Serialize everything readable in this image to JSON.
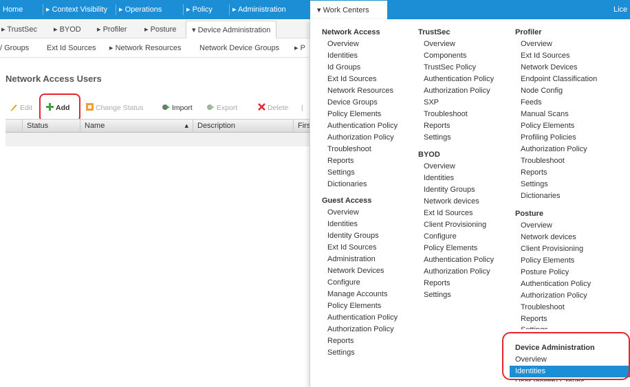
{
  "top_tabs": [
    "Home",
    "Context Visibility",
    "Operations",
    "Policy",
    "Administration",
    "Work Centers",
    "Lice"
  ],
  "sub_tabs": [
    "TrustSec",
    "BYOD",
    "Profiler",
    "Posture",
    "Device Administration"
  ],
  "third_tabs": [
    "Groups",
    "Ext Id Sources",
    "Network Resources",
    "Network Device Groups",
    "P"
  ],
  "page_title": "Network Access Users",
  "toolbar": {
    "edit": "Edit",
    "add": "Add",
    "change_status": "Change Status",
    "import": "Import",
    "export": "Export",
    "delete": "Delete"
  },
  "table": {
    "columns": [
      "Status",
      "Name",
      "Description",
      "Firs"
    ]
  },
  "menu": {
    "network_access": {
      "title": "Network Access",
      "items": [
        "Overview",
        "Identities",
        "Id Groups",
        "Ext Id Sources",
        "Network Resources",
        "Device Groups",
        "Policy Elements",
        "Authentication Policy",
        "Authorization Policy",
        "Troubleshoot",
        "Reports",
        "Settings",
        "Dictionaries"
      ]
    },
    "guest_access": {
      "title": "Guest Access",
      "items": [
        "Overview",
        "Identities",
        "Identity Groups",
        "Ext Id Sources",
        "Administration",
        "Network Devices",
        "Configure",
        "Manage Accounts",
        "Policy Elements",
        "Authentication Policy",
        "Authorization Policy",
        "Reports",
        "Settings"
      ]
    },
    "trustsec": {
      "title": "TrustSec",
      "items": [
        "Overview",
        "Components",
        "TrustSec Policy",
        "Authentication Policy",
        "Authorization Policy",
        "SXP",
        "Troubleshoot",
        "Reports",
        "Settings"
      ]
    },
    "byod": {
      "title": "BYOD",
      "items": [
        "Overview",
        "Identities",
        "Identity Groups",
        "Network devices",
        "Ext Id Sources",
        "Client Provisioning",
        "Configure",
        "Policy Elements",
        "Authentication Policy",
        "Authorization Policy",
        "Reports",
        "Settings"
      ]
    },
    "profiler": {
      "title": "Profiler",
      "items": [
        "Overview",
        "Ext Id Sources",
        "Network Devices",
        "Endpoint Classification",
        "Node Config",
        "Feeds",
        "Manual Scans",
        "Policy Elements",
        "Profiling Policies",
        "Authorization Policy",
        "Troubleshoot",
        "Reports",
        "Settings",
        "Dictionaries"
      ]
    },
    "posture": {
      "title": "Posture",
      "items": [
        "Overview",
        "Network devices",
        "Client Provisioning",
        "Policy Elements",
        "Posture Policy",
        "Authentication Policy",
        "Authorization Policy",
        "Troubleshoot",
        "Reports",
        "Settings"
      ]
    },
    "device_admin": {
      "title": "Device Administration",
      "items": [
        "Overview",
        "Identities",
        "User Identity Groups"
      ],
      "selected": "Identities"
    }
  },
  "colors": {
    "nav_blue": "#1c8ed6",
    "highlight_red": "#e8242e"
  }
}
